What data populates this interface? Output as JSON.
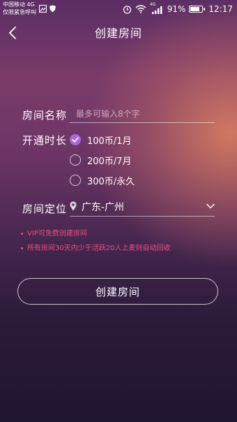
{
  "status_bar": {
    "carrier_line1": "中国移动 4G",
    "carrier_line2": "仅限紧急呼叫",
    "network_badge": "4G",
    "battery_percent": "91%",
    "battery_level": 0.91,
    "time": "12:17"
  },
  "nav": {
    "title": "创建房间",
    "back_icon": "chevron-left-icon"
  },
  "form": {
    "room_name_label": "房间名称",
    "room_name_placeholder": "最多可输入8个字",
    "room_name_value": "",
    "duration_label": "开通时长",
    "duration_options": [
      {
        "label": "100币/1月",
        "selected": true
      },
      {
        "label": "200币/7月",
        "selected": false
      },
      {
        "label": "300币/永久",
        "selected": false
      }
    ],
    "location_label": "房间定位",
    "location_value": "广东-广州",
    "location_icon": "map-pin-icon",
    "dropdown_icon": "chevron-down-icon"
  },
  "notes": [
    "VIP可免费创建房间",
    "所有房间30天内少于活跃20人上麦则自动回收"
  ],
  "actions": {
    "create_button": "创建房间"
  },
  "colors": {
    "accent_purple": "#a76bd9",
    "note_pink": "#e8507e"
  }
}
